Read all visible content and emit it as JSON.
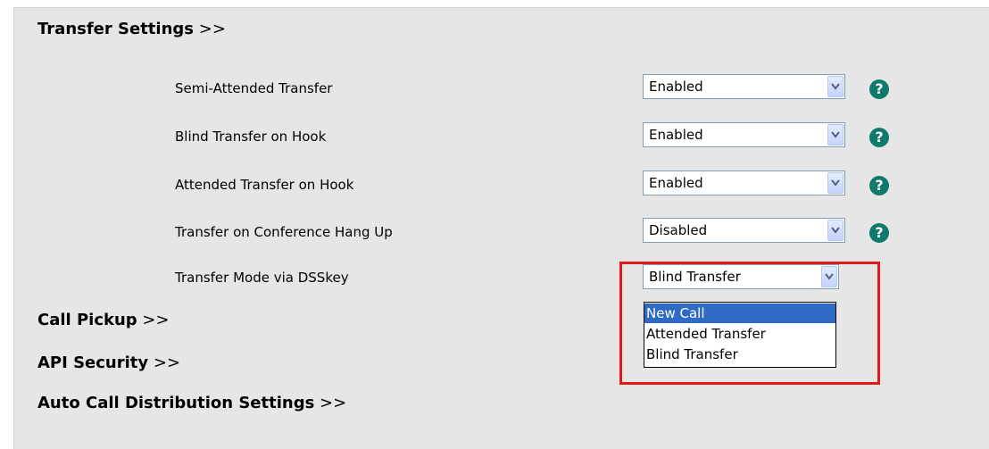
{
  "sections": {
    "transfer_settings": "Transfer Settings",
    "call_pickup": "Call Pickup",
    "api_security": "API Security",
    "auto_call_distribution": "Auto Call Distribution Settings",
    "expand_arrows": ">>"
  },
  "settings": [
    {
      "label": "Semi-Attended Transfer",
      "value": "Enabled",
      "help_icon": "question-icon"
    },
    {
      "label": "Blind Transfer on Hook",
      "value": "Enabled",
      "help_icon": "question-icon"
    },
    {
      "label": "Attended Transfer on Hook",
      "value": "Enabled",
      "help_icon": "question-icon"
    },
    {
      "label": "Transfer on Conference Hang Up",
      "value": "Disabled",
      "help_icon": "question-icon"
    },
    {
      "label": "Transfer Mode via DSSkey",
      "value": "Blind Transfer"
    }
  ],
  "dropdown": {
    "options": [
      "New Call",
      "Attended Transfer",
      "Blind Transfer"
    ],
    "highlighted": "New Call"
  },
  "help_glyph": "?",
  "colors": {
    "panel_background": "#e6e6e6",
    "help_icon": "#0e7a6c",
    "highlight_outline": "#e01a1a",
    "selected_option": "#316ac5"
  }
}
